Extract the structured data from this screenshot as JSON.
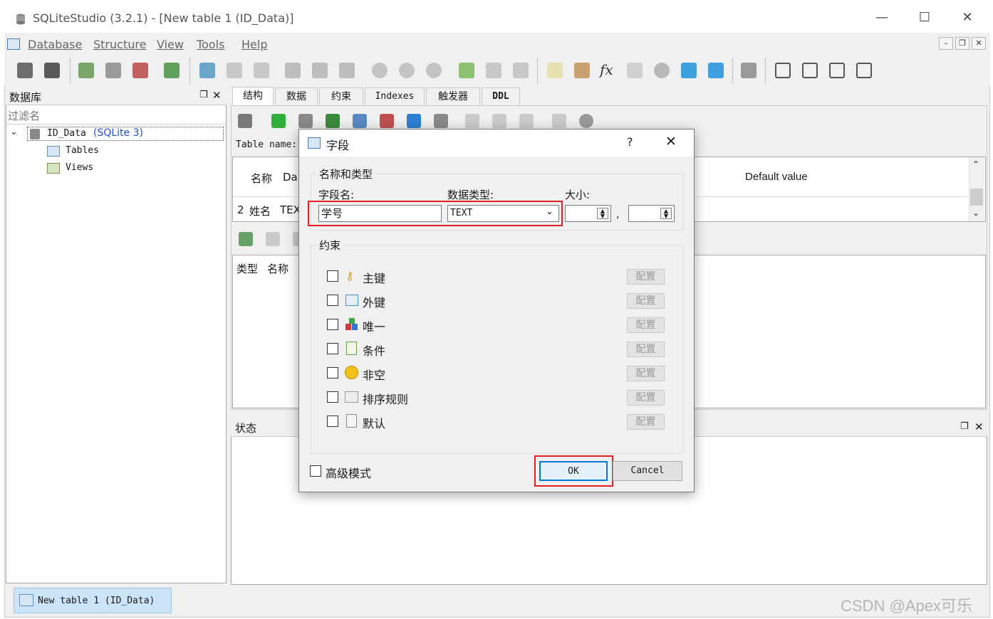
{
  "window": {
    "title": "SQLiteStudio (3.2.1) - [New table 1 (ID_Data)]"
  },
  "menu": [
    "Database",
    "Structure",
    "View",
    "Tools",
    "Help"
  ],
  "db_panel": {
    "title": "数据库",
    "filter_placeholder": "过滤名",
    "tree": {
      "db_name": "ID_Data",
      "db_type": "(SQLite 3)",
      "tables": "Tables",
      "views": "Views"
    }
  },
  "tabs": [
    "结构",
    "数据",
    "约束",
    "Indexes",
    "触发器",
    "DDL"
  ],
  "structure": {
    "table_name_label": "Table name:",
    "columns_header": {
      "num": "",
      "name": "名称",
      "type": "Da",
      "default": "Default value"
    },
    "row": {
      "num": "2",
      "name": "姓名",
      "type": "TEX"
    },
    "constraints_header": {
      "type": "类型",
      "name": "名称"
    }
  },
  "status_panel": {
    "title": "状态"
  },
  "taskbar": {
    "item": "New table 1 (ID_Data)"
  },
  "watermark": "CSDN @Apex可乐",
  "dialog": {
    "title": "字段",
    "help": "?",
    "group_name_type": "名称和类型",
    "field_name_label": "字段名:",
    "field_name_value": "学号",
    "data_type_label": "数据类型:",
    "data_type_value": "TEXT",
    "size_label": "大小:",
    "size_sep": ",",
    "group_constraints": "约束",
    "constraints": [
      {
        "label": "主键",
        "icon": "key-icon"
      },
      {
        "label": "外键",
        "icon": "foreign-key-icon"
      },
      {
        "label": "唯一",
        "icon": "unique-icon"
      },
      {
        "label": "条件",
        "icon": "check-icon"
      },
      {
        "label": "非空",
        "icon": "not-null-icon"
      },
      {
        "label": "排序规则",
        "icon": "collation-icon"
      },
      {
        "label": "默认",
        "icon": "default-icon"
      }
    ],
    "configure_label": "配置",
    "advanced_mode": "高级模式",
    "ok": "OK",
    "cancel": "Cancel"
  },
  "colors": {
    "highlight": "#e02020",
    "selection": "#cce4f7",
    "ok_border": "#0078d7"
  }
}
